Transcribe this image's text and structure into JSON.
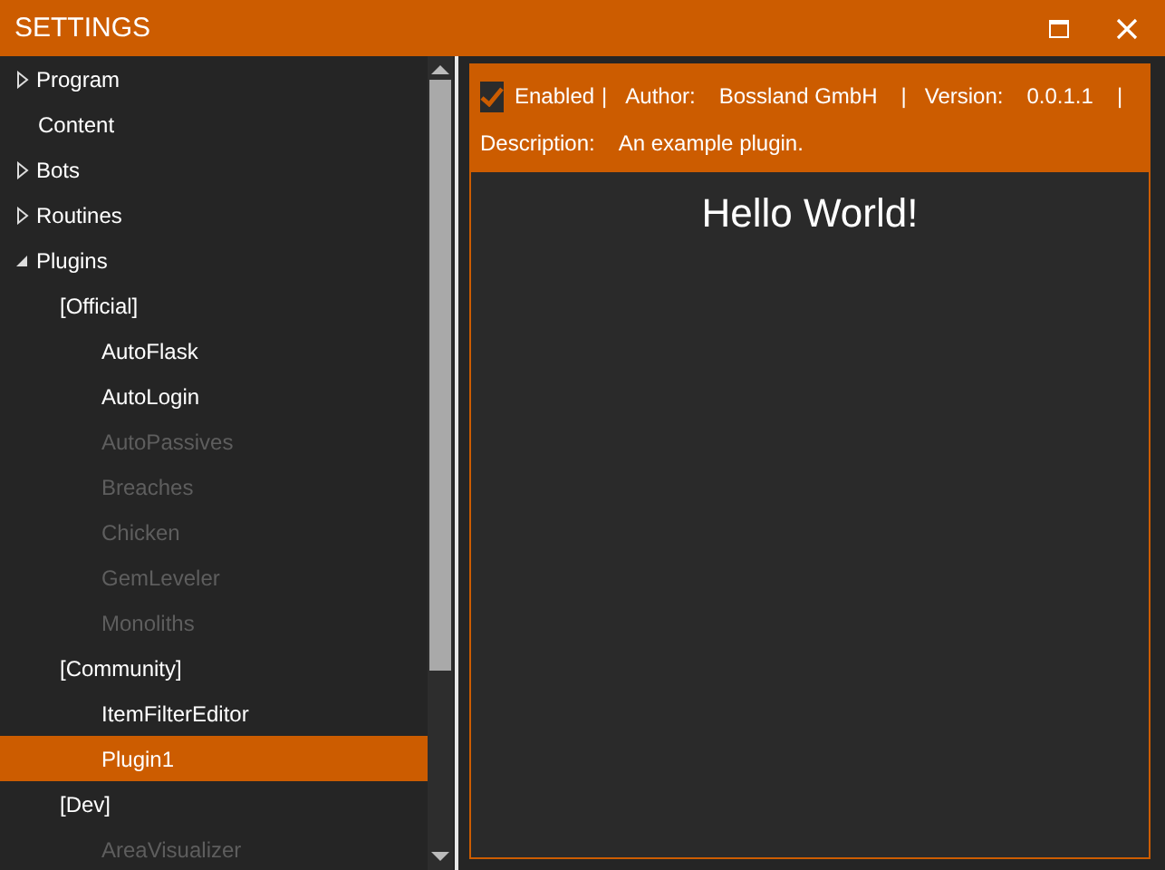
{
  "window": {
    "title": "SETTINGS"
  },
  "tree": [
    {
      "label": "Program",
      "expanded": false,
      "selected": false,
      "disabled": false
    },
    {
      "label": "Content",
      "selected": false,
      "disabled": false
    },
    {
      "label": "Bots",
      "expanded": false,
      "selected": false,
      "disabled": false
    },
    {
      "label": "Routines",
      "expanded": false,
      "selected": false,
      "disabled": false
    },
    {
      "label": "Plugins",
      "expanded": true,
      "selected": false,
      "disabled": false,
      "children": [
        {
          "label": "[Official]",
          "selected": false,
          "disabled": false,
          "children": [
            {
              "label": "AutoFlask",
              "selected": false,
              "disabled": false
            },
            {
              "label": "AutoLogin",
              "selected": false,
              "disabled": false
            },
            {
              "label": "AutoPassives",
              "selected": false,
              "disabled": true
            },
            {
              "label": "Breaches",
              "selected": false,
              "disabled": true
            },
            {
              "label": "Chicken",
              "selected": false,
              "disabled": true
            },
            {
              "label": "GemLeveler",
              "selected": false,
              "disabled": true
            },
            {
              "label": "Monoliths",
              "selected": false,
              "disabled": true
            }
          ]
        },
        {
          "label": "[Community]",
          "selected": false,
          "disabled": false,
          "children": [
            {
              "label": "ItemFilterEditor",
              "selected": false,
              "disabled": false
            },
            {
              "label": "Plugin1",
              "selected": true,
              "disabled": false
            }
          ]
        },
        {
          "label": "[Dev]",
          "selected": false,
          "disabled": false,
          "children": [
            {
              "label": "AreaVisualizer",
              "selected": false,
              "disabled": true
            }
          ]
        }
      ]
    }
  ],
  "plugin_header": {
    "enabled": {
      "label": "Enabled",
      "checked": true
    },
    "line_1": [
      {
        "kind": "separator",
        "text": "|"
      },
      {
        "kind": "label",
        "text": "Author:"
      },
      {
        "kind": "value",
        "text": "Bossland GmbH"
      },
      {
        "kind": "separator",
        "text": "|"
      },
      {
        "kind": "label",
        "text": "Version:"
      },
      {
        "kind": "value",
        "text": "0.0.1.1"
      },
      {
        "kind": "separator",
        "text": "|"
      }
    ],
    "line_2": [
      {
        "kind": "label",
        "text": "Description:"
      },
      {
        "kind": "value",
        "text": "An example plugin."
      }
    ]
  },
  "content": {
    "heading": "Hello World!"
  }
}
